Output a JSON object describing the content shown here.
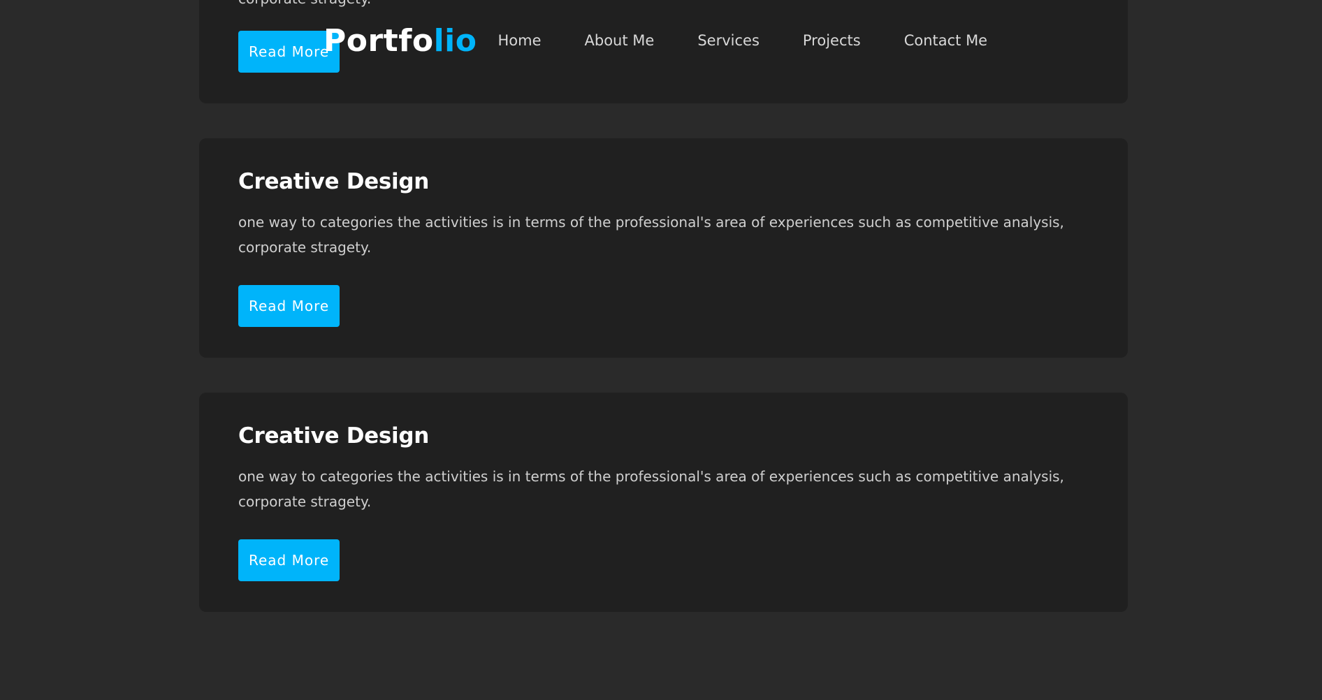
{
  "navbar": {
    "logo_main": "Portfo",
    "logo_accent": "lio",
    "items": [
      "Home",
      "About Me",
      "Services",
      "Projects",
      "Contact Me"
    ]
  },
  "cards": [
    {
      "title": "",
      "text": "corporate stragety.",
      "button": "Read More"
    },
    {
      "title": "Creative Design",
      "text": "one way to categories the activities is in terms of the professional's area of experiences such as competitive analysis, corporate stragety.",
      "button": "Read More"
    },
    {
      "title": "Creative Design",
      "text": "one way to categories the activities is in terms of the professional's area of experiences such as competitive analysis, corporate stragety.",
      "button": "Read More"
    }
  ],
  "colors": {
    "background": "#2a2a2a",
    "card": "#202020",
    "accent": "#00b4fa"
  }
}
